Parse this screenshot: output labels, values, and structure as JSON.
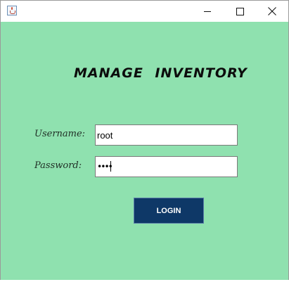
{
  "window": {
    "icon": "java-cup-icon",
    "controls": {
      "minimize": "minimize-icon",
      "maximize": "maximize-icon",
      "close": "close-icon"
    }
  },
  "form": {
    "heading": "MANAGE INVENTORY",
    "username_label": "Username:",
    "username_value": "root",
    "password_label": "Password:",
    "password_value": "••••",
    "login_label": "LOGIN"
  },
  "colors": {
    "background": "#8fe1af",
    "button": "#0e3867",
    "button_text": "#ffffff"
  }
}
